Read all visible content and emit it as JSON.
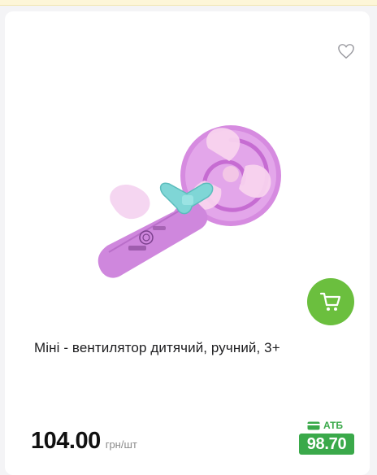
{
  "product": {
    "title": "Міні - вентилятор дитячий, ручний, 3+",
    "price": "104.00",
    "unit": "грн/шт",
    "club_label": "АТБ",
    "club_price": "98.70",
    "image_icon": "pink-lollipop-fan-image"
  },
  "icons": {
    "favorite": "heart-outline-icon",
    "cart": "cart-icon",
    "club_card": "card-icon"
  },
  "colors": {
    "accent_green": "#6bbf3e",
    "club_green": "#3aa94a",
    "background": "#f4f4f6"
  }
}
